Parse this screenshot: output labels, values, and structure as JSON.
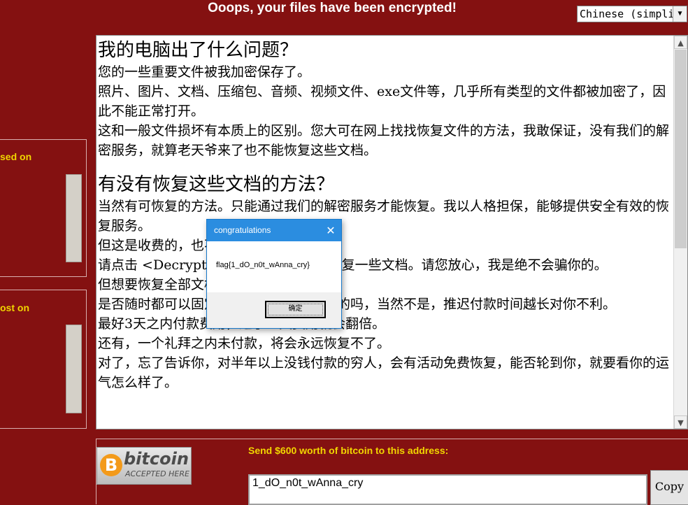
{
  "window": {
    "title": "Ooops, your files have been encrypted!",
    "language": "Chinese (simplified)"
  },
  "side_panels": {
    "payment_raise_label": "sed on",
    "files_lost_label": "ost on"
  },
  "main_text": {
    "heading1": "我的电脑出了什么问题？",
    "para1": [
      "您的一些重要文件被我加密保存了。",
      "照片、图片、文档、压缩包、音频、视频文件、exe文件等，几乎所有类型的文件都被加密了，因此不能正常打开。",
      "这和一般文件损坏有本质上的区别。您大可在网上找找恢复文件的方法，我敢保证，没有我们的解密服务，就算老天爷来了也不能恢复这些文档。"
    ],
    "heading2": "有没有恢复这些文档的方法？",
    "para2": [
      "当然有可恢复的方法。只能通过我们的解密服务才能恢复。我以人格担保，能够提供安全有效的恢复服务。",
      "但这是收费的，也不能无限期的推迟。",
      "请点击 <Decrypt> 按钮，就可以免费恢复一些文档。请您放心，我是绝不会骗你的。",
      "但想要恢复全部文档，需要付款点费用。",
      "是否随时都可以固定金额付款，就会恢复的吗，当然不是，推迟付款时间越长对你不利。",
      "最好3天之内付款费用，过了三天费用就会翻倍。",
      "还有，一个礼拜之内未付款，将会永远恢复不了。",
      "对了，忘了告诉你，对半年以上没钱付款的穷人，会有活动免费恢复，能否轮到你，就要看你的运气怎么样了。"
    ]
  },
  "bitcoin": {
    "logo_word": "bitcoin",
    "logo_sub": "ACCEPTED HERE",
    "logo_symbol": "B",
    "send_label": "Send $600 worth of bitcoin to this address:",
    "address": "1_dO_n0t_wAnna_cry",
    "copy_label": "Copy"
  },
  "dialog": {
    "title": "congratulations",
    "message": "flag{1_dO_n0t_wAnna_cry}",
    "ok_label": "确定",
    "close_glyph": "✕"
  },
  "colors": {
    "background": "#841111",
    "accent_yellow": "#f2d600",
    "dialog_titlebar": "#2b8de0",
    "bitcoin_orange": "#f39a1a"
  }
}
